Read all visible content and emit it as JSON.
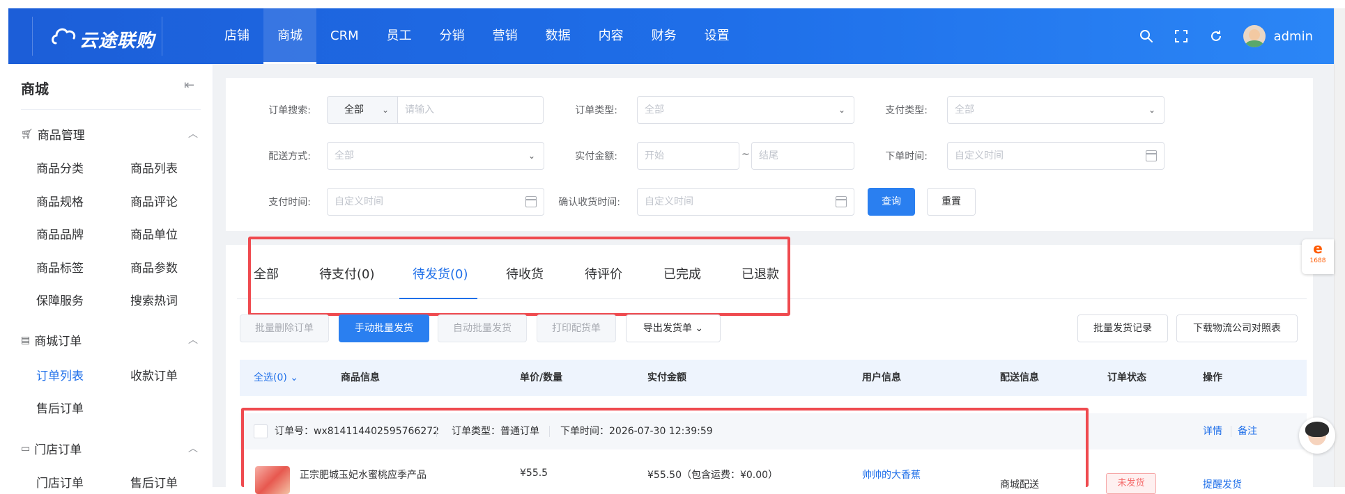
{
  "brand": {
    "logo_text": "云途联购"
  },
  "nav": {
    "items": [
      "店铺",
      "商城",
      "CRM",
      "员工",
      "分销",
      "营销",
      "数据",
      "内容",
      "财务",
      "设置"
    ],
    "active": "商城"
  },
  "header": {
    "username": "admin",
    "icons": [
      "search-icon",
      "fullscreen-icon",
      "refresh-icon"
    ]
  },
  "sidebar": {
    "title": "商城",
    "groups": [
      {
        "label": "商品管理",
        "icon": "cart-icon",
        "items": [
          "商品分类",
          "商品列表",
          "商品规格",
          "商品评论",
          "商品品牌",
          "商品单位",
          "商品标签",
          "商品参数",
          "保障服务",
          "搜索热词"
        ]
      },
      {
        "label": "商城订单",
        "icon": "list-icon",
        "items": [
          "订单列表",
          "收款订单",
          "售后订单"
        ],
        "active": "订单列表"
      },
      {
        "label": "门店订单",
        "icon": "store-icon",
        "items": [
          "门店订单",
          "售后订单"
        ]
      }
    ]
  },
  "filter": {
    "order_search": {
      "label": "订单搜索:",
      "scope": "全部",
      "placeholder": "请输入"
    },
    "order_type": {
      "label": "订单类型:",
      "placeholder": "全部"
    },
    "pay_type": {
      "label": "支付类型:",
      "placeholder": "全部"
    },
    "delivery": {
      "label": "配送方式:",
      "placeholder": "全部"
    },
    "amount": {
      "label": "实付金额:",
      "start": "开始",
      "sep": "~",
      "end": "结尾"
    },
    "order_time": {
      "label": "下单时间:",
      "placeholder": "自定义时间"
    },
    "pay_time": {
      "label": "支付时间:",
      "placeholder": "自定义时间"
    },
    "confirm_time": {
      "label": "确认收货时间:",
      "placeholder": "自定义时间"
    },
    "query_label": "查询",
    "reset_label": "重置"
  },
  "tabs": {
    "items": [
      "全部",
      "待支付(0)",
      "待发货(0)",
      "待收货",
      "待评价",
      "已完成",
      "已退款"
    ],
    "active": "待发货(0)"
  },
  "actions": {
    "left": [
      "批量删除订单",
      "手动批量发货",
      "自动批量发货",
      "打印配货单",
      "导出发货单"
    ],
    "right": [
      "批量发货记录",
      "下载物流公司对照表"
    ]
  },
  "table": {
    "select_all": "全选(0)",
    "headers": [
      "商品信息",
      "单价/数量",
      "实付金额",
      "用户信息",
      "配送信息",
      "订单状态",
      "操作"
    ]
  },
  "order": {
    "order_no": "订单号：wx814114402595766272",
    "order_type": "订单类型：普通订单",
    "order_time": "下单时间：2026-07-30 12:39:59",
    "detail_label": "详情",
    "remark_label": "备注",
    "product_name": "正宗肥城玉妃水蜜桃应季产品",
    "unit_price": "¥55.5",
    "paid": "¥55.50（包含运费：¥0.00）",
    "user": "帅帅的大香蕉",
    "delivery": "商城配送",
    "status": "未发货",
    "op": "提醒发货"
  },
  "float": {
    "label_top": "e",
    "label_bottom": "1688"
  },
  "colors": {
    "primary": "#1f6fe9",
    "highlight": "#ef4a4f",
    "danger": "#f56c6c"
  }
}
